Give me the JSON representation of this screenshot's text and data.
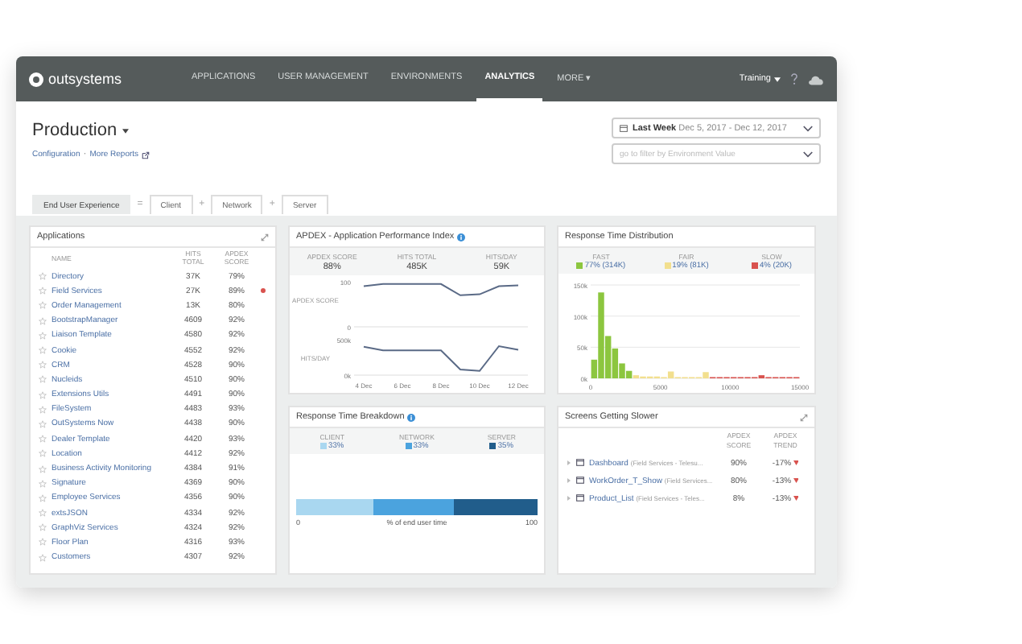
{
  "header": {
    "logo": "outsystems",
    "nav": [
      {
        "label": "APPLICATIONS",
        "selected": false
      },
      {
        "label": "USER MANAGEMENT",
        "selected": false
      },
      {
        "label": "ENVIRONMENTS",
        "selected": false
      },
      {
        "label": "ANALYTICS",
        "selected": true
      },
      {
        "label": "MORE ▾",
        "selected": false
      }
    ],
    "user": "Training"
  },
  "page": {
    "title": "Production",
    "links": [
      "Configuration",
      "More Reports"
    ],
    "separator": "·",
    "date_filter": {
      "label": "Last Week",
      "range": "Dec 5, 2017 - Dec 12, 2017"
    },
    "env_filter": {
      "placeholder": "go to filter by Environment Value"
    }
  },
  "tabs": [
    {
      "kind": "tab",
      "label": "End User Experience",
      "selected": true
    },
    {
      "kind": "operator",
      "label": "="
    },
    {
      "kind": "tab",
      "label": "Client",
      "selected": false
    },
    {
      "kind": "operator",
      "label": "+"
    },
    {
      "kind": "tab",
      "label": "Network",
      "selected": false
    },
    {
      "kind": "operator",
      "label": "+"
    },
    {
      "kind": "tab",
      "label": "Server",
      "selected": false
    }
  ],
  "applications": {
    "title": "Applications",
    "columns": [
      "NAME",
      "HITS TOTAL",
      "APDEX SCORE"
    ],
    "rows": [
      {
        "name": "Directory",
        "hits": "37K",
        "apdex": "79%",
        "alert": false
      },
      {
        "name": "Field Services",
        "hits": "27K",
        "apdex": "89%",
        "alert": true
      },
      {
        "name": "Order Management",
        "hits": "13K",
        "apdex": "80%",
        "alert": false
      },
      {
        "name": "BootstrapManager",
        "hits": "4609",
        "apdex": "92%",
        "alert": false
      },
      {
        "name": "Liaison Template",
        "hits": "4580",
        "apdex": "92%",
        "alert": false
      },
      {
        "name": "Cookie",
        "hits": "4552",
        "apdex": "92%",
        "alert": false
      },
      {
        "name": "CRM",
        "hits": "4528",
        "apdex": "90%",
        "alert": false
      },
      {
        "name": "Nucleids",
        "hits": "4510",
        "apdex": "90%",
        "alert": false
      },
      {
        "name": "Extensions Utils",
        "hits": "4491",
        "apdex": "90%",
        "alert": false
      },
      {
        "name": "FileSystem",
        "hits": "4483",
        "apdex": "93%",
        "alert": false
      },
      {
        "name": "OutSystems Now",
        "hits": "4438",
        "apdex": "90%",
        "alert": false
      },
      {
        "name": "Dealer Template",
        "hits": "4420",
        "apdex": "93%",
        "alert": false
      },
      {
        "name": "Location",
        "hits": "4412",
        "apdex": "92%",
        "alert": false
      },
      {
        "name": "Business Activity Monitoring",
        "hits": "4384",
        "apdex": "91%",
        "alert": false
      },
      {
        "name": "Signature",
        "hits": "4369",
        "apdex": "90%",
        "alert": false
      },
      {
        "name": "Employee Services",
        "hits": "4356",
        "apdex": "90%",
        "alert": false
      },
      {
        "name": "extsJSON",
        "hits": "4334",
        "apdex": "92%",
        "alert": false
      },
      {
        "name": "GraphViz Services",
        "hits": "4324",
        "apdex": "92%",
        "alert": false
      },
      {
        "name": "Floor Plan",
        "hits": "4316",
        "apdex": "93%",
        "alert": false
      },
      {
        "name": "Customers",
        "hits": "4307",
        "apdex": "92%",
        "alert": false
      }
    ]
  },
  "apdex": {
    "title": "APDEX - Application Performance Index",
    "kpis": [
      {
        "label": "APDEX SCORE",
        "value": "88%"
      },
      {
        "label": "HITS TOTAL",
        "value": "485K"
      },
      {
        "label": "HITS/DAY",
        "value": "59K"
      }
    ],
    "charts": [
      {
        "chart_data": {
          "type": "line",
          "ylabel": "APDEX SCORE",
          "categories": [
            null,
            null,
            null,
            null,
            null,
            null,
            null,
            null,
            null
          ],
          "ylim": [
            0,
            100
          ],
          "yticks": [
            {
              "value": 0,
              "label": "0"
            },
            {
              "value": 100,
              "label": "100"
            }
          ],
          "series": [
            {
              "color": "#5a6a86",
              "values": [
                90,
                95,
                95,
                95,
                95,
                70,
                72,
                90,
                92
              ]
            }
          ]
        }
      },
      {
        "chart_data": {
          "type": "line",
          "ylabel": "HITS/DAY",
          "categories": [
            "4 Dec",
            null,
            "6 Dec",
            null,
            "8 Dec",
            null,
            "10 Dec",
            null,
            "12 Dec"
          ],
          "ylim": [
            0,
            500000
          ],
          "yticks": [
            {
              "value": 0,
              "label": "0k"
            },
            {
              "value": 500000,
              "label": "500k"
            }
          ],
          "series": [
            {
              "color": "#5a6a86",
              "values": [
                400000,
                350000,
                350000,
                350000,
                350000,
                80000,
                60000,
                410000,
                360000
              ]
            }
          ]
        }
      }
    ]
  },
  "distribution": {
    "title": "Response Time Distribution",
    "legend": [
      {
        "value": "77% (314K)"
      },
      {
        "value": "19% (81K)"
      },
      {
        "value": "4% (20K)"
      }
    ],
    "chart_data": {
      "type": "bar",
      "x": [
        0,
        500,
        1000,
        1500,
        2000,
        2500,
        3000,
        3500,
        4000,
        4500,
        5000,
        5500,
        6000,
        6500,
        7000,
        7500,
        8000,
        8500,
        9000,
        9500,
        10000,
        10500,
        11000,
        11500,
        12000,
        12500,
        13000,
        13500,
        14000,
        14500
      ],
      "xlim": [
        0,
        15000
      ],
      "ylim": [
        0,
        150000
      ],
      "xticks": [
        {
          "value": 0,
          "label": "0"
        },
        {
          "value": 5000,
          "label": "5000"
        },
        {
          "value": 10000,
          "label": "10000"
        },
        {
          "value": 15000,
          "label": "15000"
        }
      ],
      "yticks": [
        {
          "value": 0,
          "label": "0k"
        },
        {
          "value": 50000,
          "label": "50k"
        },
        {
          "value": 100000,
          "label": "100k"
        },
        {
          "value": 150000,
          "label": "150k"
        }
      ],
      "series": [
        {
          "name": "FAST",
          "color": "#8cc63f",
          "values": [
            30000,
            138000,
            68000,
            48000,
            24000,
            12000,
            null,
            null,
            null,
            null,
            null,
            null,
            null,
            null,
            null,
            null,
            null,
            null,
            null,
            null,
            null,
            null,
            null,
            null,
            null,
            null,
            null,
            null,
            null,
            null
          ]
        },
        {
          "name": "FAIR",
          "color": "#f2df8e",
          "values": [
            null,
            null,
            null,
            null,
            null,
            null,
            5000,
            3000,
            3000,
            3000,
            2000,
            11000,
            2000,
            2000,
            2000,
            2000,
            10000,
            null,
            null,
            null,
            null,
            null,
            null,
            null,
            null,
            null,
            null,
            null,
            null,
            null
          ]
        },
        {
          "name": "SLOW",
          "color": "#d9534f",
          "values": [
            null,
            null,
            null,
            null,
            null,
            null,
            null,
            null,
            null,
            null,
            null,
            null,
            null,
            null,
            null,
            null,
            null,
            2000,
            2000,
            2000,
            2000,
            2000,
            2000,
            2000,
            5000,
            2000,
            2000,
            2000,
            2000,
            2000
          ]
        }
      ]
    }
  },
  "breakdown": {
    "title": "Response Time Breakdown",
    "legend": [
      {
        "value": "33%"
      },
      {
        "value": "33%"
      },
      {
        "value": "35%"
      }
    ],
    "chart_data": {
      "type": "bar",
      "orientation": "horizontal",
      "stacked": true,
      "xlabel": "% of end user time",
      "xlim": [
        0,
        100
      ],
      "xticks": [
        {
          "value": 0,
          "label": "0"
        },
        {
          "value": 100,
          "label": "100"
        }
      ],
      "series": [
        {
          "name": "CLIENT",
          "color": "#a9d7f0",
          "values": [
            32
          ]
        },
        {
          "name": "NETWORK",
          "color": "#4ba3de",
          "values": [
            33
          ]
        },
        {
          "name": "SERVER",
          "color": "#215d8b",
          "values": [
            35
          ]
        }
      ]
    }
  },
  "slower": {
    "title": "Screens Getting Slower",
    "columns": [
      "APDEX SCORE",
      "APDEX TREND"
    ],
    "rows": [
      {
        "name": "Dashboard",
        "context": "(Field Services - Telesu...",
        "score": "90%",
        "trend": "-17%",
        "expanded": false
      },
      {
        "name": "WorkOrder_T_Show",
        "context": "(Field Services...",
        "score": "80%",
        "trend": "-13%",
        "expanded": false
      },
      {
        "name": "Product_List",
        "context": "(Field Services - Teles...",
        "score": "8%",
        "trend": "-13%",
        "expanded": false
      }
    ]
  }
}
